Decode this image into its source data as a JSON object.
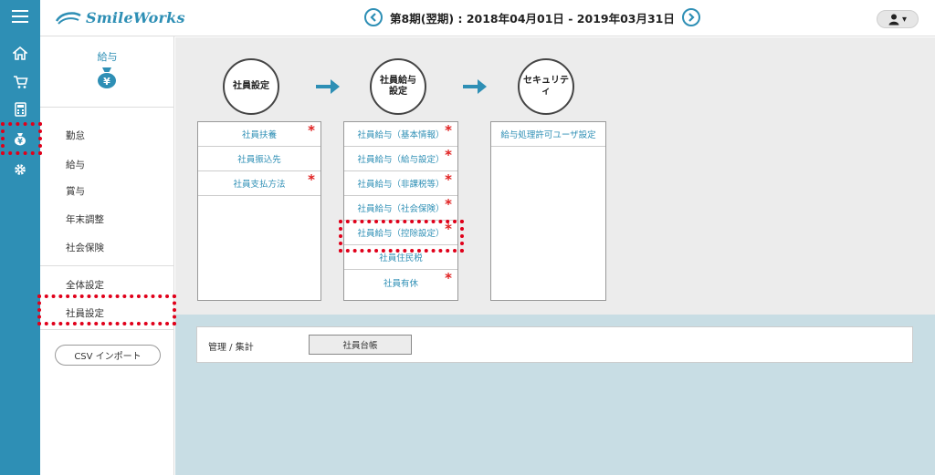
{
  "header": {
    "brand": "SmileWorks",
    "period": "第8期(翌期) : 2018年04月01日 - 2019年03月31日",
    "user_caret": "▾"
  },
  "colors": {
    "accent": "#2e8fb5",
    "highlight": "#e0001a",
    "content_bg": "#ececec",
    "lower_bg": "#c8dde4"
  },
  "rail": {
    "icons": [
      "menu-icon",
      "home-icon",
      "cart-icon",
      "calculator-icon",
      "money-bag-icon",
      "gear-icon"
    ]
  },
  "menu": {
    "section_title": "給与",
    "items": [
      "勤怠",
      "給与",
      "賞与",
      "年末調整",
      "社会保険"
    ],
    "settings": [
      "全体設定",
      "社員設定"
    ],
    "csv_button": "CSV インポート"
  },
  "steps": [
    "社員設定",
    "社員給与\n設定",
    "セキュリティ"
  ],
  "columns": [
    {
      "cells": [
        {
          "label": "社員扶養",
          "required": "*"
        },
        {
          "label": "社員振込先",
          "required": ""
        },
        {
          "label": "社員支払方法",
          "required": "*"
        }
      ]
    },
    {
      "cells": [
        {
          "label": "社員給与（基本情報）",
          "required": "*"
        },
        {
          "label": "社員給与（給与設定）",
          "required": "*"
        },
        {
          "label": "社員給与（非課税等）",
          "required": "*"
        },
        {
          "label": "社員給与（社会保険）",
          "required": "*"
        },
        {
          "label": "社員給与（控除設定）",
          "required": "*"
        },
        {
          "label": "社員住民税",
          "required": ""
        },
        {
          "label": "社員有休",
          "required": "*"
        }
      ]
    },
    {
      "cells": [
        {
          "label": "給与処理許可ユーザ設定",
          "required": ""
        }
      ]
    }
  ],
  "management": {
    "label": "管理 / 集計",
    "button": "社員台帳"
  }
}
